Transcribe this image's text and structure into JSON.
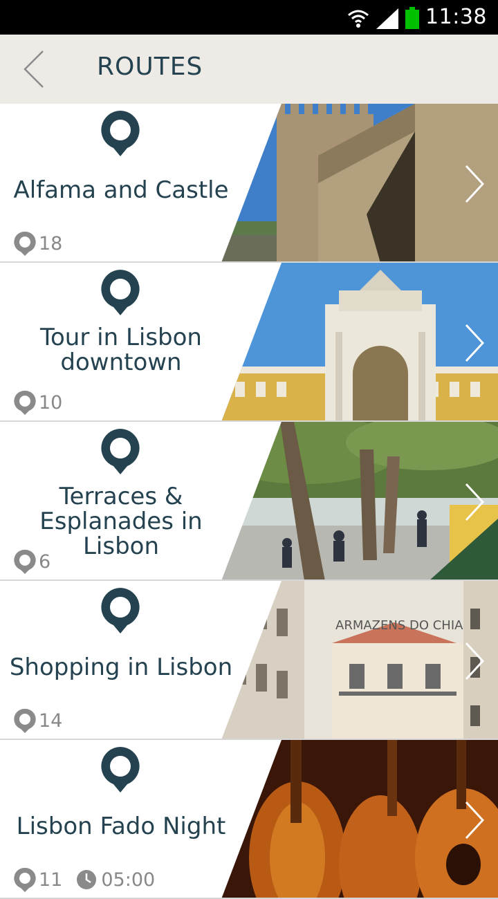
{
  "status_bar": {
    "time": "11:38",
    "icons": [
      "wifi-icon",
      "signal-icon",
      "battery-icon"
    ],
    "battery_color": "#00c000"
  },
  "header": {
    "title": "ROUTES",
    "back_icon": "back-arrow-icon"
  },
  "colors": {
    "accent": "#24424f",
    "header_bg": "#eeebe6",
    "count_text": "#888888"
  },
  "routes": [
    {
      "title": "Alfama and Castle",
      "count": "18"
    },
    {
      "title_line1": "Tour in Lisbon",
      "title_line2": "downtown",
      "count": "10"
    },
    {
      "title_line1": "Terraces &",
      "title_line2": "Esplanades in Lisbon",
      "count": "6"
    },
    {
      "title": "Shopping in Lisbon",
      "count": "14",
      "sign_text": "ARMAZENS DO CHIADO"
    },
    {
      "title": "Lisbon Fado Night",
      "count": "11",
      "duration": "05:00"
    }
  ]
}
